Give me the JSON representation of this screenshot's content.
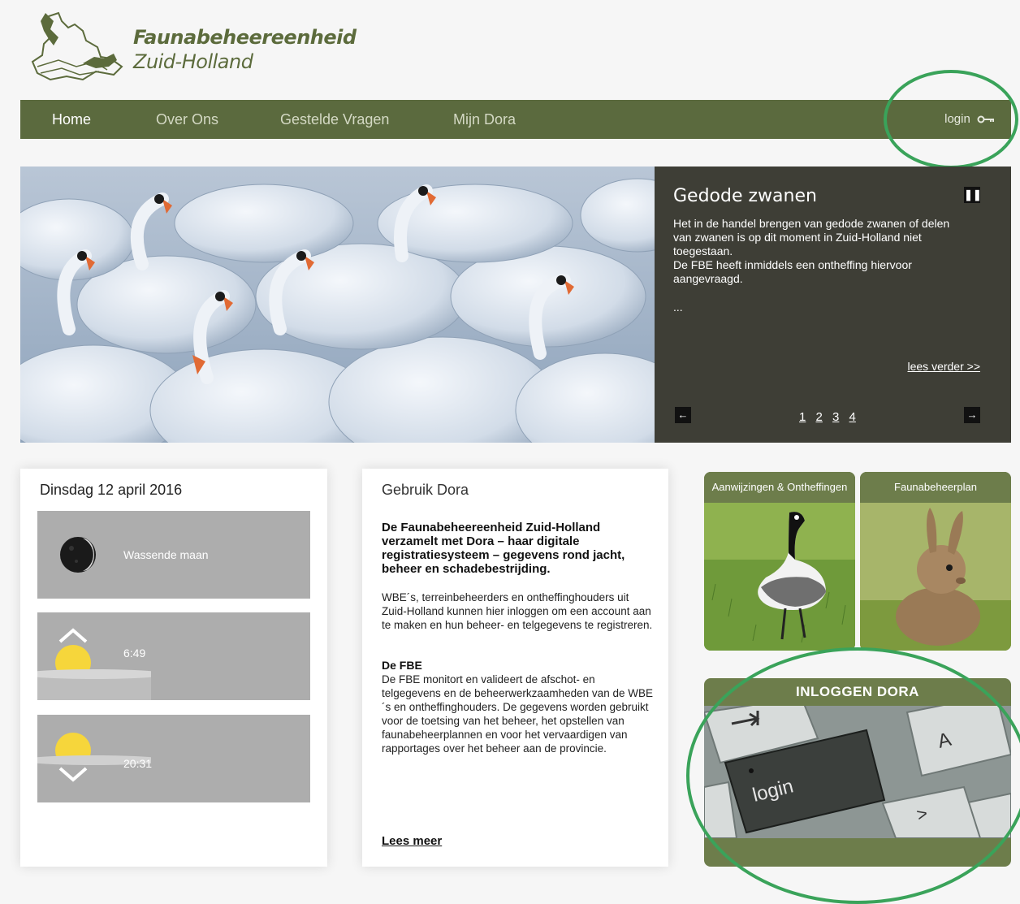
{
  "header": {
    "logo_title": "Faunabeheereenheid",
    "logo_subtitle": "Zuid-Holland"
  },
  "nav": {
    "items": [
      {
        "label": "Home",
        "active": true
      },
      {
        "label": "Over Ons"
      },
      {
        "label": "Gestelde Vragen"
      },
      {
        "label": "Mijn Dora"
      }
    ],
    "login_label": "login",
    "login_icon": "key-icon"
  },
  "slider": {
    "title": "Gedode zwanen",
    "text_1": "Het in de handel brengen van gedode zwanen of delen van zwanen is op dit moment in Zuid-Holland niet toegestaan.",
    "text_2": "De FBE heeft inmiddels een ontheffing hiervoor aangevraagd.",
    "ellipsis": "...",
    "read_more": "lees verder >>",
    "pause_icon": "pause-icon",
    "pages": [
      "1",
      "2",
      "3",
      "4"
    ]
  },
  "weather": {
    "date": "Dinsdag 12 april 2016",
    "moon_label": "Wassende maan",
    "sunrise": "6:49",
    "sunset": "20:31"
  },
  "dora": {
    "title": "Gebruik Dora",
    "intro": "De Faunabeheereenheid Zuid-Holland verzamelt met Dora – haar digitale registratiesysteem – gegevens rond jacht, beheer en schadebestrijding.",
    "body": "WBE´s, terreinbeheerders en ontheffinghouders uit Zuid-Holland kunnen hier inloggen om een account aan te maken en hun beheer- en telgegevens te registreren.",
    "fbe_heading": "De FBE",
    "fbe_body": "De FBE monitort en valideert de afschot- en telgegevens en de beheerwerkzaamheden van de WBE´s en ontheffinghouders. De gegevens worden gebruikt voor de toetsing van het beheer, het opstellen van faunabeheerplannen en voor het vervaardigen van rapportages over het beheer aan de provincie.",
    "read_more": "Lees meer"
  },
  "tiles": {
    "aanwijzingen": "Aanwijzingen & Ontheffingen",
    "faunabeheerplan": "Faunabeheerplan"
  },
  "login_panel": {
    "title": "INLOGGEN DORA",
    "key_label": "login",
    "key_a": "A",
    "key_gt": ">"
  },
  "colors": {
    "nav_bg": "#5b6a3e",
    "tile_green": "#6d7d4b",
    "highlight_circle": "#3aa35a"
  }
}
